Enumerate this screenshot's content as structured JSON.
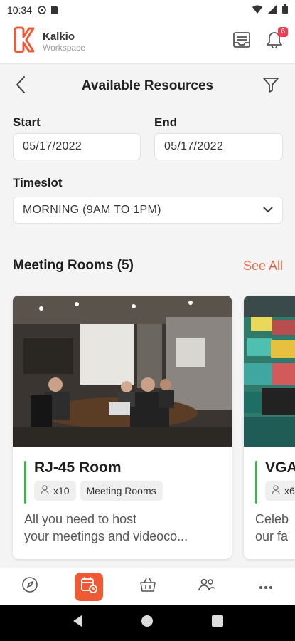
{
  "status_bar": {
    "time": "10:34"
  },
  "app": {
    "name": "Kalkio",
    "subtitle": "Workspace",
    "notification_count": "6",
    "accent": "#ee5a36"
  },
  "header": {
    "title": "Available Resources"
  },
  "form": {
    "start_label": "Start",
    "start_value": "05/17/2022",
    "end_label": "End",
    "end_value": "05/17/2022",
    "timeslot_label": "Timeslot",
    "timeslot_value": "MORNING (9AM TO 1PM)"
  },
  "section": {
    "title": "Meeting Rooms (5)",
    "see_all": "See All"
  },
  "cards": [
    {
      "name": "RJ-45 Room",
      "capacity": "x10",
      "type": "Meeting Rooms",
      "desc_line1": "All you need to host",
      "desc_line2": "your meetings and videoco..."
    },
    {
      "name": "VGA",
      "capacity": "x6",
      "desc_line1": "Celeb",
      "desc_line2": "our fa"
    }
  ],
  "bottom_nav": [
    "compass-icon",
    "calendar-clock-icon",
    "basket-icon",
    "people-icon",
    "more-icon"
  ]
}
